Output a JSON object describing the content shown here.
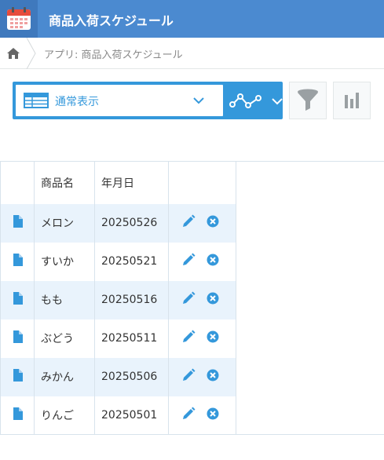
{
  "app": {
    "title": "商品入荷スケジュール",
    "icon": "calendar-icon",
    "header_color": "#4b8ad0"
  },
  "breadcrumb": {
    "home_icon": "home-icon",
    "text": "アプリ: 商品入荷スケジュール"
  },
  "toolbar": {
    "view_label": "通常表示",
    "view_icon": "table-icon",
    "graph_icon": "graph-icon",
    "filter_icon": "funnel-icon",
    "chart_icon": "bar-chart-icon",
    "accent": "#3498db"
  },
  "table": {
    "headers": [
      "",
      "商品名",
      "年月日",
      ""
    ],
    "rows": [
      {
        "name": "メロン",
        "date": "20250526"
      },
      {
        "name": "すいか",
        "date": "20250521"
      },
      {
        "name": "もも",
        "date": "20250516"
      },
      {
        "name": "ぶどう",
        "date": "20250511"
      },
      {
        "name": "みかん",
        "date": "20250506"
      },
      {
        "name": "りんご",
        "date": "20250501"
      }
    ]
  }
}
